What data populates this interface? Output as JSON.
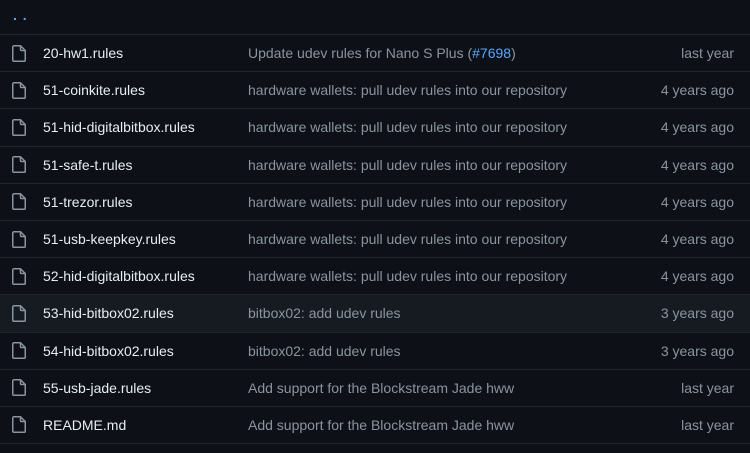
{
  "parent_dir": {
    "label": ". ."
  },
  "files": [
    {
      "name": "20-hw1.rules",
      "message_before": "Update udev rules for Nano S Plus (",
      "message_link": "#7698",
      "message_after": ")",
      "age": "last year",
      "highlighted": false
    },
    {
      "name": "51-coinkite.rules",
      "message": "hardware wallets: pull udev rules into our repository",
      "age": "4 years ago",
      "highlighted": false
    },
    {
      "name": "51-hid-digitalbitbox.rules",
      "message": "hardware wallets: pull udev rules into our repository",
      "age": "4 years ago",
      "highlighted": false
    },
    {
      "name": "51-safe-t.rules",
      "message": "hardware wallets: pull udev rules into our repository",
      "age": "4 years ago",
      "highlighted": false
    },
    {
      "name": "51-trezor.rules",
      "message": "hardware wallets: pull udev rules into our repository",
      "age": "4 years ago",
      "highlighted": false
    },
    {
      "name": "51-usb-keepkey.rules",
      "message": "hardware wallets: pull udev rules into our repository",
      "age": "4 years ago",
      "highlighted": false
    },
    {
      "name": "52-hid-digitalbitbox.rules",
      "message": "hardware wallets: pull udev rules into our repository",
      "age": "4 years ago",
      "highlighted": false
    },
    {
      "name": "53-hid-bitbox02.rules",
      "message": "bitbox02: add udev rules",
      "age": "3 years ago",
      "highlighted": true
    },
    {
      "name": "54-hid-bitbox02.rules",
      "message": "bitbox02: add udev rules",
      "age": "3 years ago",
      "highlighted": false
    },
    {
      "name": "55-usb-jade.rules",
      "message": "Add support for the Blockstream Jade hww",
      "age": "last year",
      "highlighted": false
    },
    {
      "name": "README.md",
      "message": "Add support for the Blockstream Jade hww",
      "age": "last year",
      "highlighted": false
    }
  ],
  "icon": "file-icon",
  "colors": {
    "background": "#0d1117",
    "row_highlight": "#161b22",
    "border": "#21262d",
    "filename": "#e6edf3",
    "muted": "#8b949e",
    "link": "#58a6ff"
  }
}
